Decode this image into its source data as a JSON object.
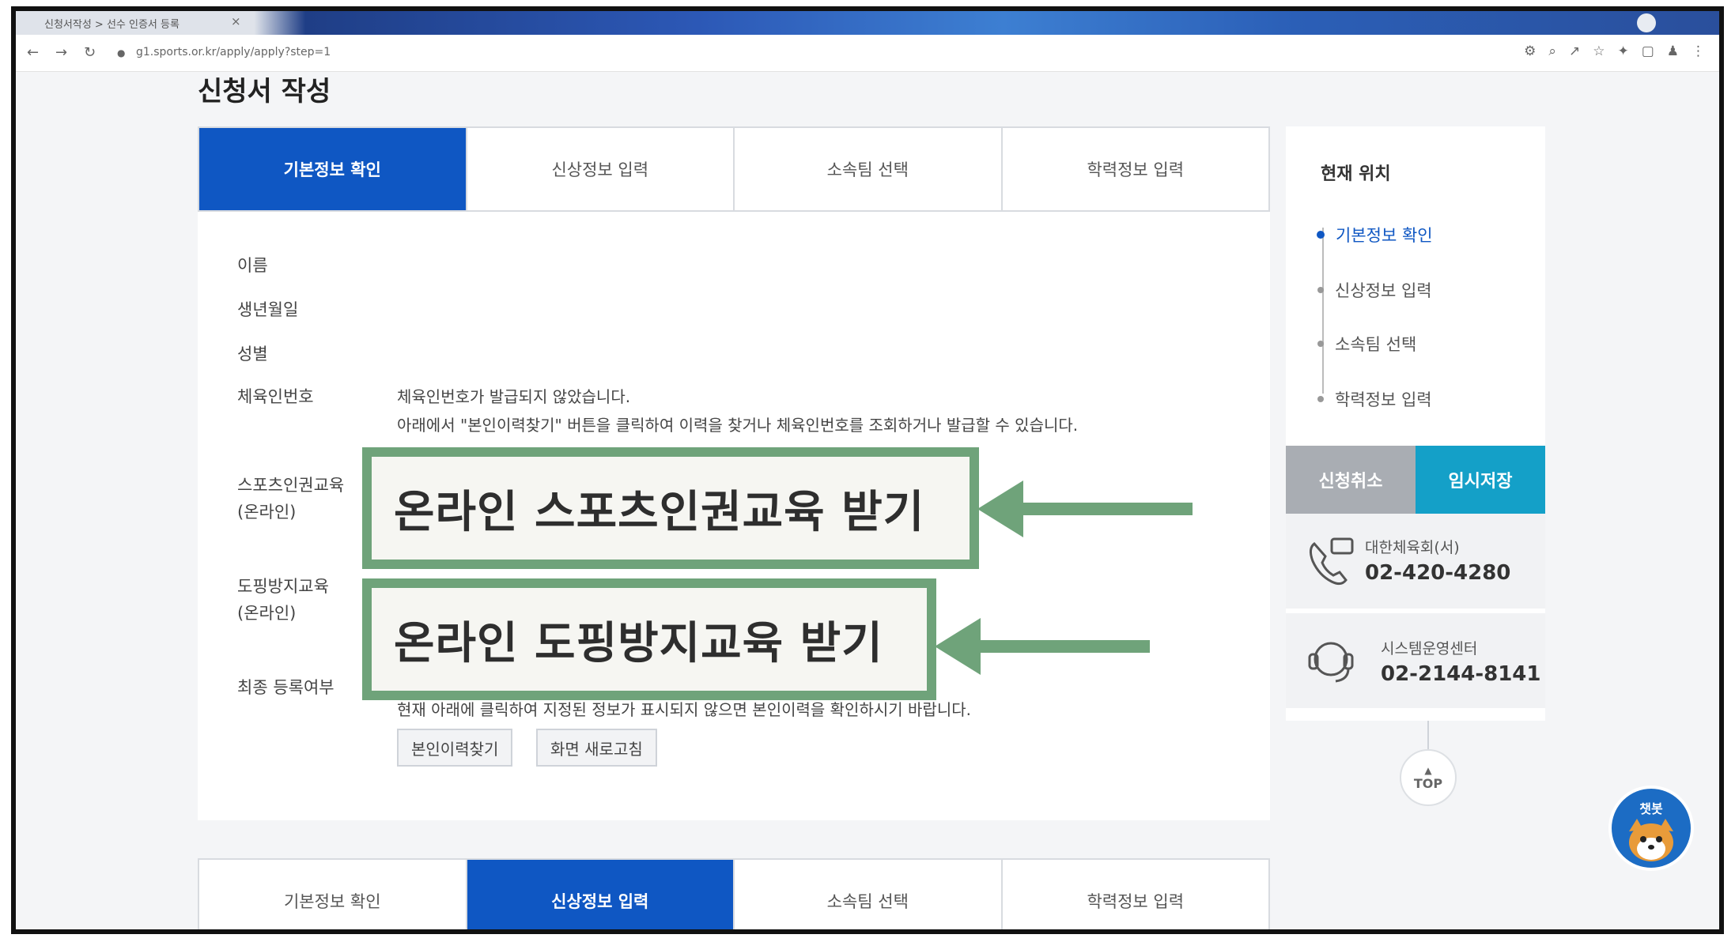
{
  "browser": {
    "tab_title": "신청서작성 > 선수 인증서 등록",
    "url": "g1.sports.or.kr/apply/apply?step=1"
  },
  "page": {
    "title": "신청서 작성"
  },
  "steps_top": [
    {
      "label": "기본정보 확인",
      "active": true
    },
    {
      "label": "신상정보 입력",
      "active": false
    },
    {
      "label": "소속팀 선택",
      "active": false
    },
    {
      "label": "학력정보 입력",
      "active": false
    }
  ],
  "form": {
    "name_label": "이름",
    "birth_label": "생년월일",
    "gender_label": "성별",
    "reg_no_label": "체육인번호",
    "reg_no_note_1": "체육인번호가 발급되지 않았습니다.",
    "reg_no_note_2": "아래에서 \"본인이력찾기\" 버튼을 클릭하여 이력을 찾거나 체육인번호를 조회하거나 발급할 수 있습니다.",
    "sports_edu_label_1": "스포츠인권교육",
    "sports_edu_label_2": "(온라인)",
    "doping_edu_label_1": "도핑방지교육",
    "doping_edu_label_2": "(온라인)",
    "final_label": "최종 등록여부",
    "final_note": "현재 아래에 클릭하여 지정된 정보가 표시되지 않으면 본인이력을 확인하시기 바랍니다.",
    "btn_history": "본인이력찾기",
    "btn_refresh": "화면 새로고침"
  },
  "overlays": {
    "sports": "온라인 스포츠인권교육 받기",
    "doping": "온라인 도핑방지교육 받기"
  },
  "sidebar": {
    "title": "현재 위치",
    "items": [
      {
        "label": "기본정보 확인",
        "active": true
      },
      {
        "label": "신상정보 입력",
        "active": false
      },
      {
        "label": "소속팀 선택",
        "active": false
      },
      {
        "label": "학력정보 입력",
        "active": false
      }
    ],
    "cancel": "신청취소",
    "save": "임시저장",
    "contacts": [
      {
        "name": "대한체육회(서)",
        "phone": "02-420-4280"
      },
      {
        "name": "시스템운영센터",
        "phone": "02-2144-8141"
      }
    ],
    "top": "TOP"
  },
  "steps_bottom": [
    {
      "label": "기본정보 확인",
      "active": false
    },
    {
      "label": "신상정보 입력",
      "active": true
    },
    {
      "label": "소속팀 선택",
      "active": false
    },
    {
      "label": "학력정보 입력",
      "active": false
    }
  ],
  "chatbot": {
    "label": "챗봇"
  },
  "colors": {
    "primary": "#0f57c3",
    "save": "#14a0c8",
    "cancel": "#a9adb3",
    "overlay": "#6fa37a"
  }
}
